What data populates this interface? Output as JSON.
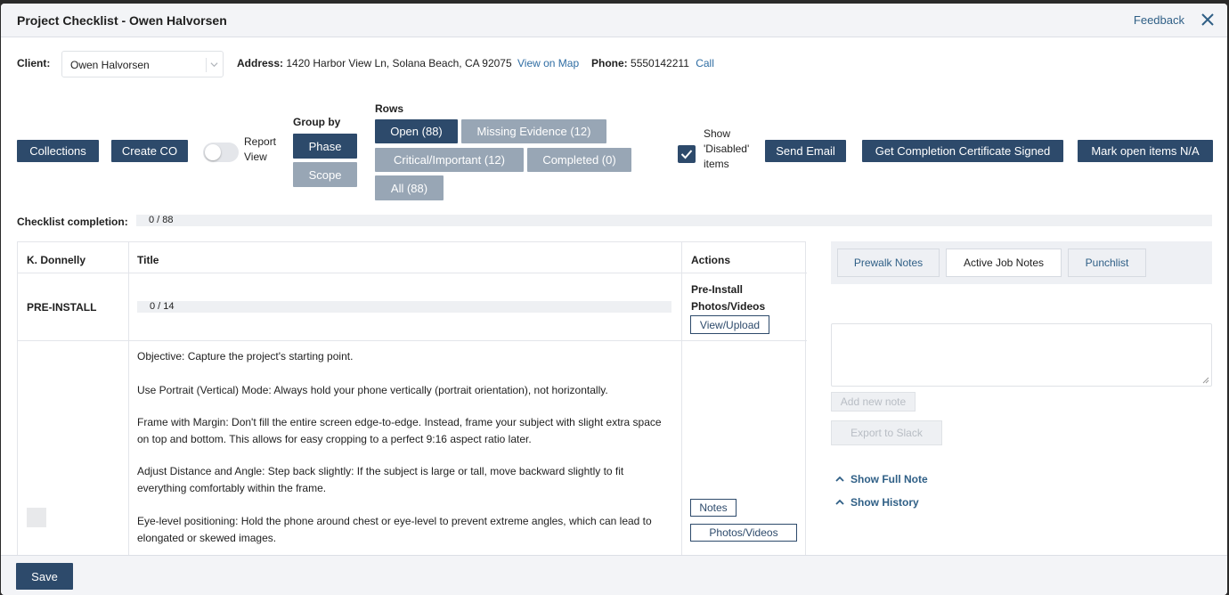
{
  "header": {
    "title": "Project Checklist - Owen Halvorsen",
    "feedback": "Feedback"
  },
  "client": {
    "label": "Client:",
    "value": "Owen Halvorsen"
  },
  "address": {
    "label": "Address:",
    "value": "1420 Harbor View Ln, Solana Beach, CA 92075",
    "link": "View on Map"
  },
  "phone": {
    "label": "Phone:",
    "value": "5550142211",
    "link": "Call"
  },
  "toolbar": {
    "collections": "Collections",
    "create_co": "Create CO",
    "report_view_line1": "Report",
    "report_view_line2": "View",
    "group_by_label": "Group by",
    "phase": "Phase",
    "scope": "Scope",
    "rows_label": "Rows",
    "open": "Open (88)",
    "missing_evidence": "Missing Evidence (12)",
    "critical": "Critical/Important (12)",
    "completed": "Completed (0)",
    "all": "All (88)",
    "show_disabled_1": "Show",
    "show_disabled_2": "'Disabled'",
    "show_disabled_3": "items",
    "send_email": "Send Email",
    "certificate": "Get Completion Certificate Signed",
    "mark_na": "Mark open items N/A"
  },
  "completion": {
    "label": "Checklist completion:",
    "value": "0 / 88",
    "progress": 0
  },
  "table": {
    "col_assignee": "K. Donnelly",
    "col_title": "Title",
    "col_actions": "Actions",
    "section": {
      "name": "PRE-INSTALL",
      "progress_text": "0 / 14",
      "progress": 0,
      "action_line1": "Pre-Install",
      "action_line2": "Photos/Videos",
      "view_upload": "View/Upload"
    },
    "item": {
      "p1": "Objective: Capture the project's starting point.",
      "p2": "Use Portrait (Vertical) Mode: Always hold your phone vertically (portrait orientation), not horizontally.",
      "p3a": "Frame with Margin: Don't fill the entire screen edge-to-edge. Instead, frame your subject with slight extra space",
      "p3b": "on top and bottom. This allows for easy cropping to a perfect 9:16 aspect ratio later.",
      "p4a": "Adjust Distance and Angle: Step back slightly: If the subject is large or tall, move backward slightly to fit",
      "p4b": "everything comfortably within the frame.",
      "p5a": "Eye-level positioning: Hold the phone around chest or eye-level to prevent extreme angles, which can lead to",
      "p5b": "elongated or skewed images.",
      "notes": "Notes",
      "photos": "Photos/Videos"
    }
  },
  "notes": {
    "tabs": [
      "Prewalk Notes",
      "Active Job Notes",
      "Punchlist"
    ],
    "active_tab": "Active Job Notes",
    "add_note": "Add new note",
    "export": "Export to Slack",
    "show_full": "Show Full Note",
    "show_history": "Show History"
  },
  "footer": {
    "save": "Save"
  },
  "colors": {
    "primary": "#2d4a6b",
    "muted": "#98a6b5",
    "link": "#2f6da3"
  }
}
